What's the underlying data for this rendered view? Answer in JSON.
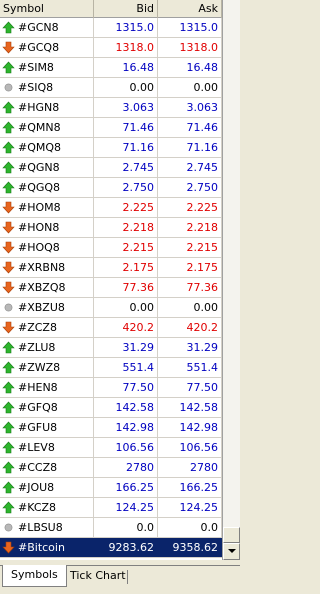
{
  "columns": {
    "symbol": "Symbol",
    "bid": "Bid",
    "ask": "Ask"
  },
  "rows": [
    {
      "symbol": "#GCN8",
      "bid": "1315.0",
      "ask": "1315.0",
      "dir": "up"
    },
    {
      "symbol": "#GCQ8",
      "bid": "1318.0",
      "ask": "1318.0",
      "dir": "down"
    },
    {
      "symbol": "#SIM8",
      "bid": "16.48",
      "ask": "16.48",
      "dir": "up"
    },
    {
      "symbol": "#SIQ8",
      "bid": "0.00",
      "ask": "0.00",
      "dir": "none"
    },
    {
      "symbol": "#HGN8",
      "bid": "3.063",
      "ask": "3.063",
      "dir": "up"
    },
    {
      "symbol": "#QMN8",
      "bid": "71.46",
      "ask": "71.46",
      "dir": "up"
    },
    {
      "symbol": "#QMQ8",
      "bid": "71.16",
      "ask": "71.16",
      "dir": "up"
    },
    {
      "symbol": "#QGN8",
      "bid": "2.745",
      "ask": "2.745",
      "dir": "up"
    },
    {
      "symbol": "#QGQ8",
      "bid": "2.750",
      "ask": "2.750",
      "dir": "up"
    },
    {
      "symbol": "#HOM8",
      "bid": "2.225",
      "ask": "2.225",
      "dir": "down"
    },
    {
      "symbol": "#HON8",
      "bid": "2.218",
      "ask": "2.218",
      "dir": "down"
    },
    {
      "symbol": "#HOQ8",
      "bid": "2.215",
      "ask": "2.215",
      "dir": "down"
    },
    {
      "symbol": "#XRBN8",
      "bid": "2.175",
      "ask": "2.175",
      "dir": "down"
    },
    {
      "symbol": "#XBZQ8",
      "bid": "77.36",
      "ask": "77.36",
      "dir": "down"
    },
    {
      "symbol": "#XBZU8",
      "bid": "0.00",
      "ask": "0.00",
      "dir": "none"
    },
    {
      "symbol": "#ZCZ8",
      "bid": "420.2",
      "ask": "420.2",
      "dir": "down"
    },
    {
      "symbol": "#ZLU8",
      "bid": "31.29",
      "ask": "31.29",
      "dir": "up"
    },
    {
      "symbol": "#ZWZ8",
      "bid": "551.4",
      "ask": "551.4",
      "dir": "up"
    },
    {
      "symbol": "#HEN8",
      "bid": "77.50",
      "ask": "77.50",
      "dir": "up"
    },
    {
      "symbol": "#GFQ8",
      "bid": "142.58",
      "ask": "142.58",
      "dir": "up"
    },
    {
      "symbol": "#GFU8",
      "bid": "142.98",
      "ask": "142.98",
      "dir": "up"
    },
    {
      "symbol": "#LEV8",
      "bid": "106.56",
      "ask": "106.56",
      "dir": "up"
    },
    {
      "symbol": "#CCZ8",
      "bid": "2780",
      "ask": "2780",
      "dir": "up"
    },
    {
      "symbol": "#JOU8",
      "bid": "166.25",
      "ask": "166.25",
      "dir": "up"
    },
    {
      "symbol": "#KCZ8",
      "bid": "124.25",
      "ask": "124.25",
      "dir": "up"
    },
    {
      "symbol": "#LBSU8",
      "bid": "0.0",
      "ask": "0.0",
      "dir": "none"
    },
    {
      "symbol": "#Bitcoin",
      "bid": "9283.62",
      "ask": "9358.62",
      "dir": "down",
      "selected": true
    }
  ],
  "tabs": {
    "symbols": "Symbols",
    "tick_chart": "Tick Chart"
  },
  "colors": {
    "up": "#0000c0",
    "down": "#e00000",
    "none": "#000000",
    "up_arrow": "#2db52d",
    "down_arrow": "#e8641e",
    "selected_bg": "#0a246a"
  },
  "icons": {
    "up": "arrow-up-icon",
    "down": "arrow-down-icon",
    "none": "grey-dot-icon"
  }
}
